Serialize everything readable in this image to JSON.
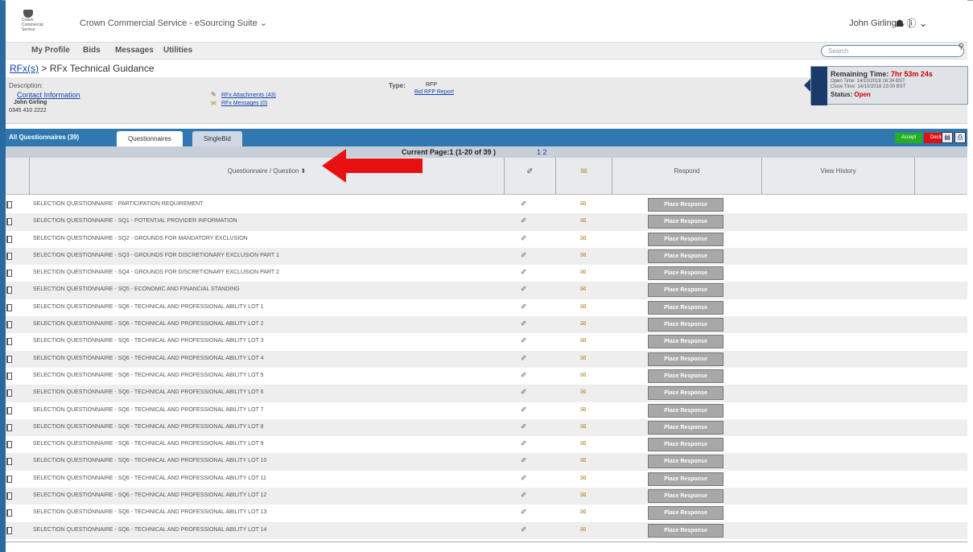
{
  "header": {
    "logo_text": "Crown Commercial Service",
    "app_title": "Crown Commercial Service - eSourcing Suite",
    "user_name": "John Girling",
    "search_placeholder": "Search"
  },
  "menu": [
    "My Profile",
    "Bids",
    "Messages",
    "Utilities"
  ],
  "breadcrumb": {
    "link": "RFx(s)",
    "current": "RFx Technical Guidance"
  },
  "info": {
    "description_label": "Description:",
    "contact_link": "Contact Information",
    "contact_name": "John Girling",
    "contact_phone": "0345 410 2222",
    "attachments_link": "RFx Attachments (43)",
    "messages_link": "RFx Messages (0)",
    "type_label": "Type:",
    "type_value": "RFP",
    "report_link": "Bid RFP Report"
  },
  "timer": {
    "remaining_label": "Remaining Time:",
    "remaining_value": "7hr 53m 24s",
    "open_time": "Open Time: 14/10/2018 16:34 BST",
    "close_time": "Close Time: 14/10/2018 23:00 BST",
    "status_label": "Status:",
    "status_value": "Open"
  },
  "tabs": {
    "all_label": "All Questionnaires (39)",
    "tab1": "Questionnaires",
    "tab2": "SingleBid",
    "accept": "Accept",
    "decline": "Decline"
  },
  "pager": {
    "text": "Current Page:1  (1-20  of 39 )",
    "pages": "1 2"
  },
  "columns": {
    "question": "Questionnaire / Question",
    "response": "Respond",
    "history": "View History"
  },
  "button_label": "Place Response",
  "rows": [
    "SELECTION QUESTIONNAIRE - PARTICIPATION REQUIREMENT",
    "SELECTION QUESTIONNAIRE - SQ1 - POTENTIAL PROVIDER INFORMATION",
    "SELECTION QUESTIONNAIRE - SQ2 - GROUNDS FOR MANDATORY EXCLUSION",
    "SELECTION QUESTIONNAIRE - SQ3 - GROUNDS FOR DISCRETIONARY EXCLUSION PART 1",
    "SELECTION QUESTIONNAIRE - SQ4 - GROUNDS FOR DISCRETIONARY EXCLUSION PART 2",
    "SELECTION QUESTIONNAIRE - SQ5 - ECONOMIC AND FINANCIAL STANDING",
    "SELECTION QUESTIONNAIRE - SQ6 - TECHNICAL AND PROFESSIONAL ABILITY LOT 1",
    "SELECTION QUESTIONNAIRE - SQ6 - TECHNICAL AND PROFESSIONAL ABILITY LOT 2",
    "SELECTION QUESTIONNAIRE - SQ6 - TECHNICAL AND PROFESSIONAL ABILITY LOT 3",
    "SELECTION QUESTIONNAIRE - SQ6 - TECHNICAL AND PROFESSIONAL ABILITY LOT 4",
    "SELECTION QUESTIONNAIRE - SQ6 - TECHNICAL AND PROFESSIONAL ABILITY LOT 5",
    "SELECTION QUESTIONNAIRE - SQ6 - TECHNICAL AND PROFESSIONAL ABILITY LOT 6",
    "SELECTION QUESTIONNAIRE - SQ6 - TECHNICAL AND PROFESSIONAL ABILITY LOT 7",
    "SELECTION QUESTIONNAIRE - SQ6 - TECHNICAL AND PROFESSIONAL ABILITY LOT 8",
    "SELECTION QUESTIONNAIRE - SQ6 - TECHNICAL AND PROFESSIONAL ABILITY LOT 9",
    "SELECTION QUESTIONNAIRE - SQ6 - TECHNICAL AND PROFESSIONAL ABILITY LOT 10",
    "SELECTION QUESTIONNAIRE - SQ6 - TECHNICAL AND PROFESSIONAL ABILITY LOT 11",
    "SELECTION QUESTIONNAIRE - SQ6 - TECHNICAL AND PROFESSIONAL ABILITY LOT 12",
    "SELECTION QUESTIONNAIRE - SQ6 - TECHNICAL AND PROFESSIONAL ABILITY LOT 13",
    "SELECTION QUESTIONNAIRE - SQ6 - TECHNICAL AND PROFESSIONAL ABILITY LOT 14"
  ],
  "colors": {
    "tab_bar": "#2f78b0",
    "accept": "#22b022",
    "decline": "#dd1111",
    "arrow": "#e81010"
  }
}
